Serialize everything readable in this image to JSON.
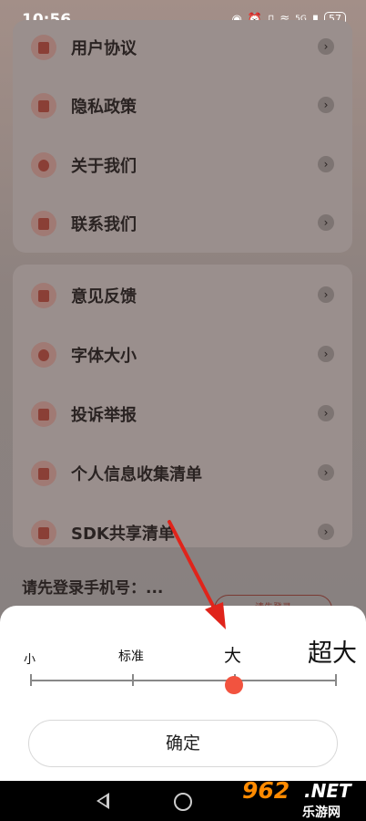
{
  "status_bar": {
    "time": "10:56",
    "network": "5G",
    "battery": "57"
  },
  "menu_card_1": [
    {
      "label": "用户协议"
    },
    {
      "label": "隐私政策"
    },
    {
      "label": "关于我们"
    },
    {
      "label": "联系我们"
    }
  ],
  "menu_card_2": [
    {
      "label": "意见反馈"
    },
    {
      "label": "字体大小"
    },
    {
      "label": "投诉举报"
    },
    {
      "label": "个人信息收集清单"
    },
    {
      "label": "SDK共享清单"
    }
  ],
  "login": {
    "prompt": "请先登录手机号：...",
    "button": "请先登录"
  },
  "font_sheet": {
    "sizes": [
      "小",
      "标准",
      "大",
      "超大"
    ],
    "selected": "大",
    "confirm": "确定"
  },
  "watermark": {
    "brand": "962",
    "suffix": ".NET",
    "cn": "乐游网"
  }
}
